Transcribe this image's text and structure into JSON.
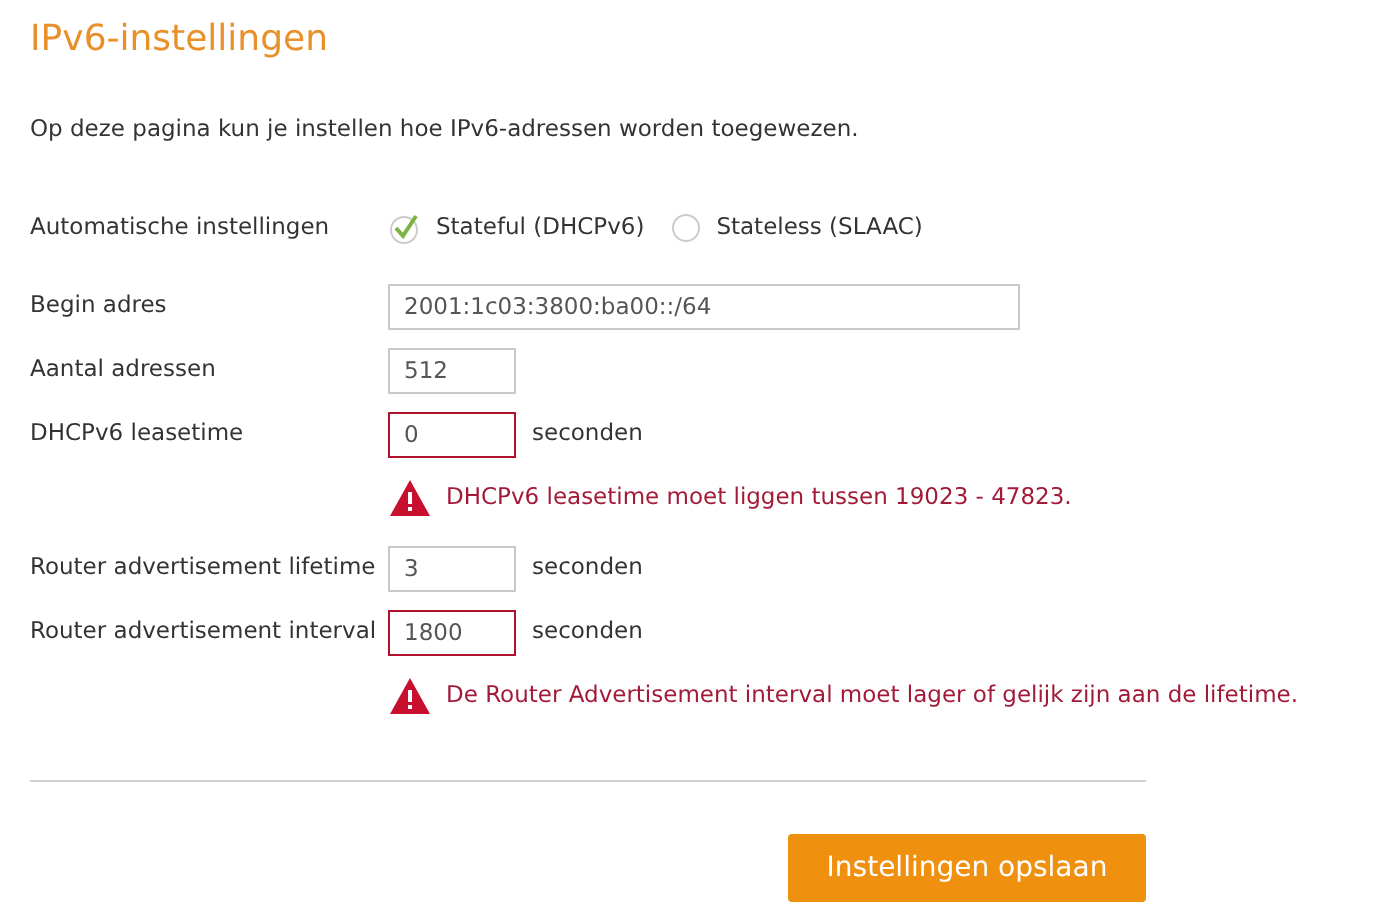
{
  "title": "IPv6-instellingen",
  "intro": "Op deze pagina kun je instellen hoe IPv6-adressen worden toegewezen.",
  "rows": [
    {
      "kind": "radio",
      "label": "Automatische instellingen",
      "options": [
        {
          "label": "Stateful (DHCPv6)",
          "selected": true
        },
        {
          "label": "Stateless (SLAAC)",
          "selected": false
        }
      ]
    },
    {
      "kind": "long_input",
      "label": "Begin adres",
      "value": "2001:1c03:3800:ba00::/64",
      "invalid": false
    },
    {
      "kind": "short_input",
      "label": "Aantal adressen",
      "value": "512",
      "invalid": false
    },
    {
      "kind": "short_input",
      "label": "DHCPv6 leasetime",
      "value": "0",
      "unit": "seconden",
      "invalid": true
    },
    {
      "kind": "error",
      "text": "DHCPv6 leasetime moet liggen tussen 19023 - 47823."
    },
    {
      "kind": "short_input",
      "label": "Router advertisement lifetime",
      "value": "3",
      "unit": "seconden",
      "invalid": false
    },
    {
      "kind": "short_input",
      "label": "Router advertisement interval",
      "value": "1800",
      "unit": "seconden",
      "invalid": true
    },
    {
      "kind": "error",
      "text": "De Router Advertisement interval moet lager of gelijk zijn aan de lifetime."
    }
  ],
  "save_button": "Instellingen opslaan"
}
